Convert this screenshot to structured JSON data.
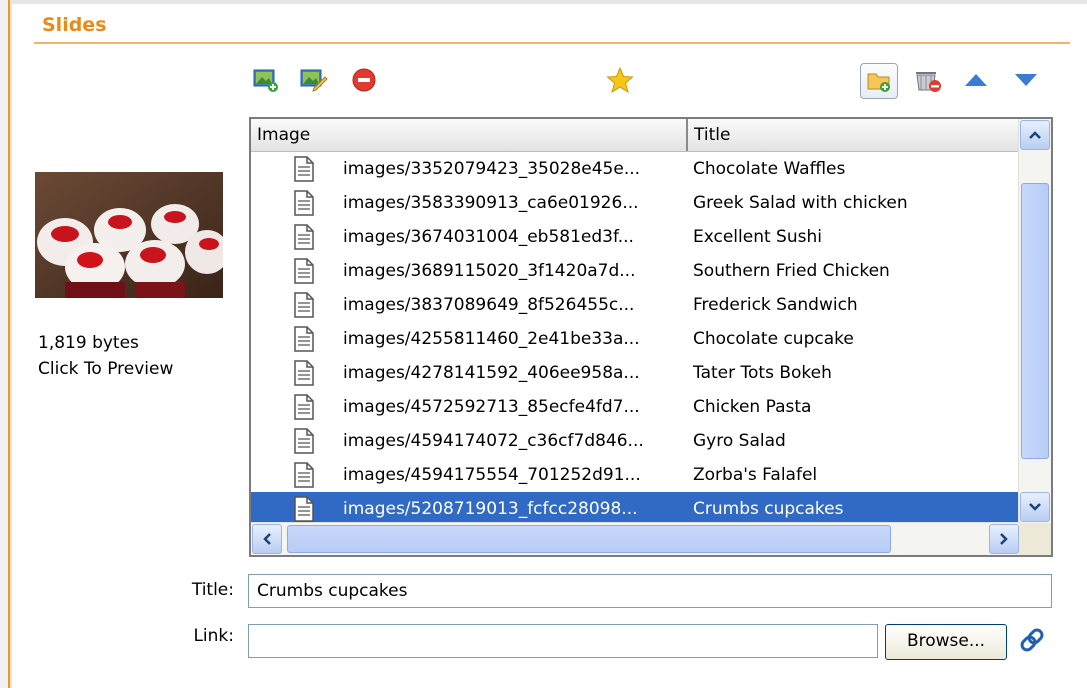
{
  "section": {
    "title": "Slides"
  },
  "toolbar": {
    "icons": [
      "add-image-icon",
      "edit-image-icon",
      "delete-icon",
      "star-icon",
      "add-folder-icon",
      "remove-item-icon",
      "move-up-icon",
      "move-down-icon"
    ],
    "colors": {
      "accent": "#e88b17",
      "up_down_arrows": "#3a7bd5",
      "delete": "#e23a2e",
      "star": "#f5c518"
    }
  },
  "preview": {
    "size_text": "1,819 bytes",
    "action_text": "Click To Preview"
  },
  "grid": {
    "columns": {
      "image": "Image",
      "title": "Title"
    },
    "rows": [
      {
        "image": "images/3352079423_35028e45e...",
        "title": "Chocolate Waffles"
      },
      {
        "image": "images/3583390913_ca6e01926...",
        "title": "Greek Salad with chicken"
      },
      {
        "image": "images/3674031004_eb581ed3f...",
        "title": "Excellent Sushi"
      },
      {
        "image": "images/3689115020_3f1420a7d...",
        "title": "Southern Fried Chicken"
      },
      {
        "image": "images/3837089649_8f526455c...",
        "title": "Frederick Sandwich"
      },
      {
        "image": "images/4255811460_2e41be33a...",
        "title": "Chocolate cupcake"
      },
      {
        "image": "images/4278141592_406ee958a...",
        "title": "Tater Tots Bokeh"
      },
      {
        "image": "images/4572592713_85ecfe4fd7...",
        "title": "Chicken Pasta"
      },
      {
        "image": "images/4594174072_c36cf7d846...",
        "title": "Gyro Salad"
      },
      {
        "image": "images/4594175554_701252d91...",
        "title": "Zorba's Falafel"
      },
      {
        "image": "images/5208719013_fcfcc28098...",
        "title": "Crumbs cupcakes"
      }
    ],
    "selected_index": 10,
    "selection_color": "#316ac5"
  },
  "form": {
    "title_label": "Title:",
    "title_value": "Crumbs cupcakes",
    "link_label": "Link:",
    "link_value": "",
    "browse_label": "Browse..."
  }
}
